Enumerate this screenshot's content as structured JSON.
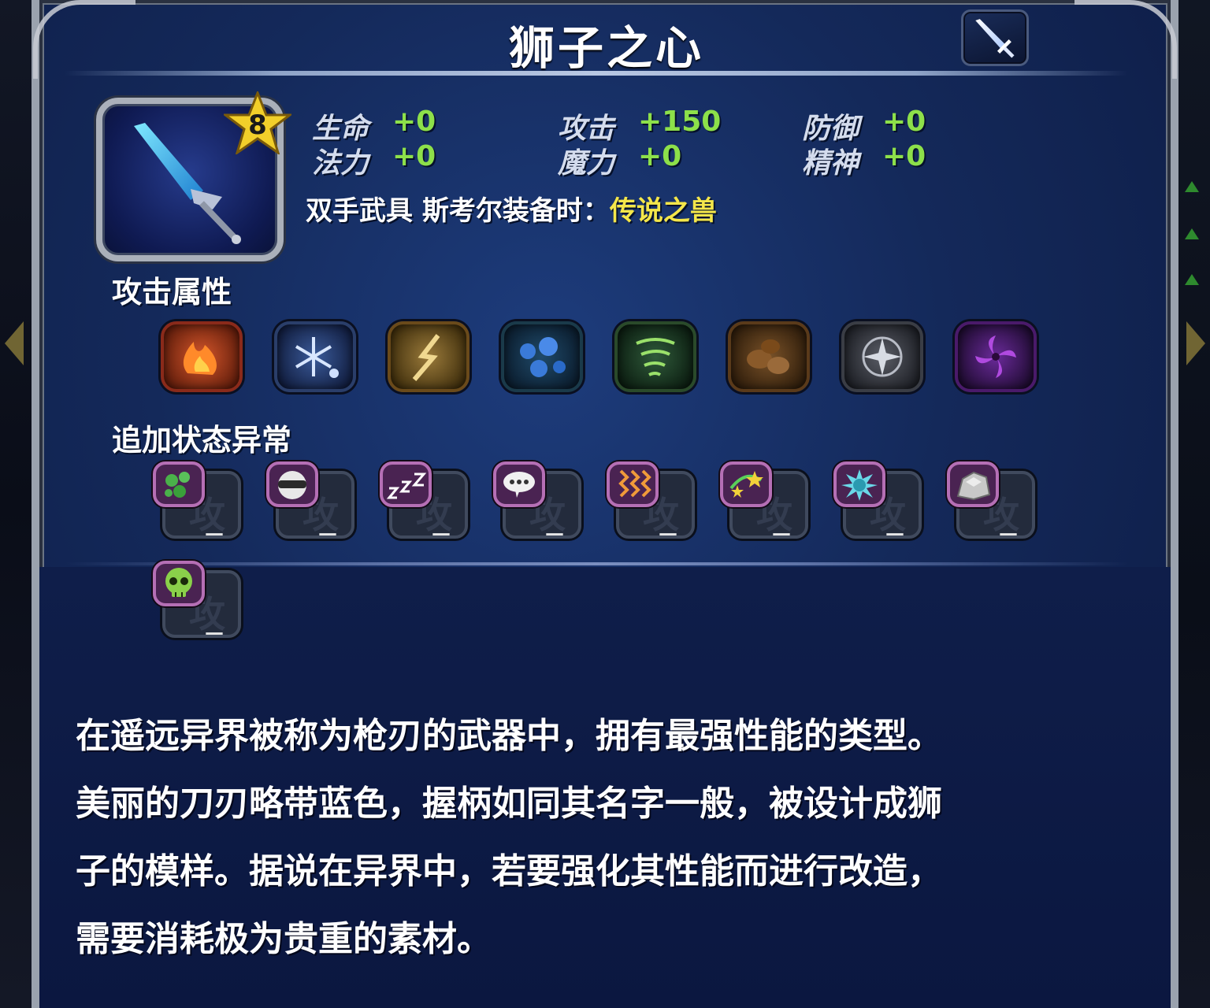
{
  "title": "狮子之心",
  "item_type_icon": "sword-icon",
  "rarity_stars": 8,
  "stats": [
    {
      "label": "生命",
      "value": "+0"
    },
    {
      "label": "攻击",
      "value": "+150"
    },
    {
      "label": "防御",
      "value": "+0"
    },
    {
      "label": "法力",
      "value": "+0"
    },
    {
      "label": "魔力",
      "value": "+0"
    },
    {
      "label": "精神",
      "value": "+0"
    }
  ],
  "equip_info": {
    "prefix": "双手武具 斯考尔装备时：",
    "highlight": "传说之兽"
  },
  "sections": {
    "attack_attributes": "攻击属性",
    "status_ailments": "追加状态异常"
  },
  "elements": [
    {
      "name": "fire-icon",
      "color": "#b8452a"
    },
    {
      "name": "ice-icon",
      "color": "#2e4a86"
    },
    {
      "name": "lightning-icon",
      "color": "#7a5a22"
    },
    {
      "name": "water-icon",
      "color": "#1f4a6a"
    },
    {
      "name": "wind-icon",
      "color": "#2f5a3a"
    },
    {
      "name": "earth-icon",
      "color": "#6a4520"
    },
    {
      "name": "holy-icon",
      "color": "#4a4d55"
    },
    {
      "name": "dark-icon",
      "color": "#5a2a7a"
    }
  ],
  "status_effects": [
    {
      "name": "poison-icon",
      "ghost": "攻",
      "value": "－"
    },
    {
      "name": "blind-icon",
      "ghost": "攻",
      "value": "－"
    },
    {
      "name": "sleep-icon",
      "ghost": "攻",
      "value": "－"
    },
    {
      "name": "silence-icon",
      "ghost": "攻",
      "value": "－"
    },
    {
      "name": "paralysis-icon",
      "ghost": "攻",
      "value": "－"
    },
    {
      "name": "confuse-icon",
      "ghost": "攻",
      "value": "－"
    },
    {
      "name": "disease-icon",
      "ghost": "攻",
      "value": "－"
    },
    {
      "name": "petrify-icon",
      "ghost": "攻",
      "value": "－"
    },
    {
      "name": "death-icon",
      "ghost": "攻",
      "value": "－"
    }
  ],
  "description": [
    "在遥远异界被称为枪刃的武器中，拥有最强性能的类型。",
    "美丽的刀刃略带蓝色，握柄如同其名字一般，被设计成狮",
    "子的模样。据说在异界中，若要强化其性能而进行改造，",
    "需要消耗极为贵重的素材。"
  ]
}
